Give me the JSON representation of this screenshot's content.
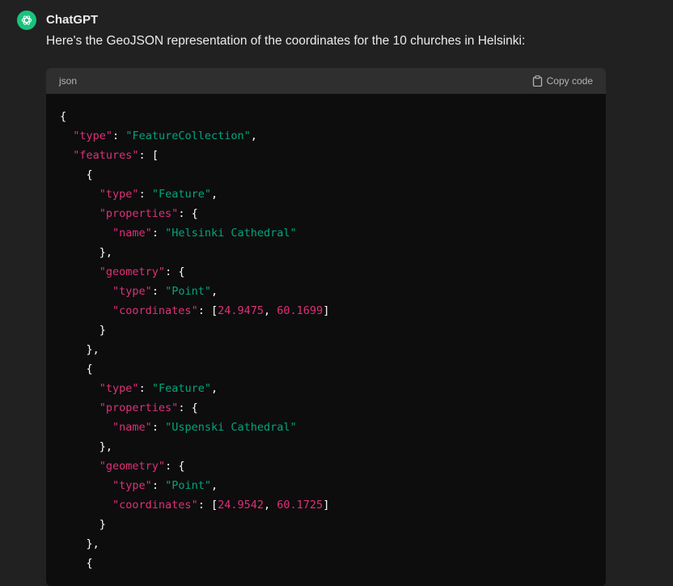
{
  "message": {
    "author": "ChatGPT",
    "avatar_icon": "openai-logo-icon",
    "avatar_color": "#19c37d",
    "intro": "Here's the GeoJSON representation of the coordinates for the 10 churches in Helsinki:"
  },
  "code_block": {
    "language": "json",
    "copy_label": "Copy code",
    "colors": {
      "key": "#df3079",
      "string": "#00a67d",
      "number": "#df3079",
      "punctuation": "#ffffff"
    },
    "lines": [
      "{",
      "  \"type\": \"FeatureCollection\",",
      "  \"features\": [",
      "    {",
      "      \"type\": \"Feature\",",
      "      \"properties\": {",
      "        \"name\": \"Helsinki Cathedral\"",
      "      },",
      "      \"geometry\": {",
      "        \"type\": \"Point\",",
      "        \"coordinates\": [24.9475, 60.1699]",
      "      }",
      "    },",
      "    {",
      "      \"type\": \"Feature\",",
      "      \"properties\": {",
      "        \"name\": \"Uspenski Cathedral\"",
      "      },",
      "      \"geometry\": {",
      "        \"type\": \"Point\",",
      "        \"coordinates\": [24.9542, 60.1725]",
      "      }",
      "    },",
      "    {"
    ]
  }
}
